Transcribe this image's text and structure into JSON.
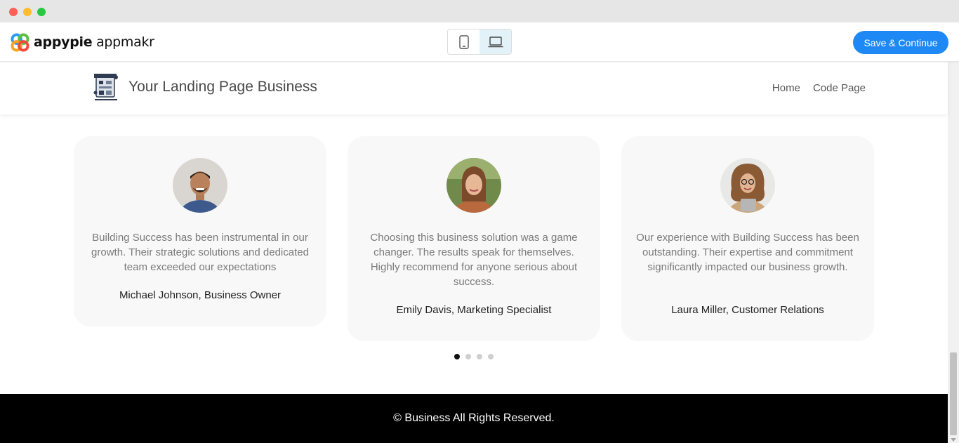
{
  "window": {
    "controls": [
      "close",
      "minimize",
      "maximize"
    ]
  },
  "toolbar": {
    "brand_bold": "appypie",
    "brand_light": "appmakr",
    "device_toggle": {
      "options": [
        "mobile-icon",
        "desktop-icon"
      ],
      "selected": "desktop"
    },
    "save_label": "Save & Continue",
    "accent_color": "#1e88f5"
  },
  "site": {
    "title": "Your Landing Page Business",
    "nav": {
      "home": "Home",
      "code_page": "Code Page"
    }
  },
  "testimonials": [
    {
      "quote": "Building Success has been instrumental in our growth. Their strategic solutions and dedicated team exceeded our expectations",
      "author": "Michael Johnson, Business Owner"
    },
    {
      "quote": "Choosing this business solution was a game changer. The results speak for themselves. Highly recommend for anyone serious about success.",
      "author": "Emily Davis, Marketing Specialist"
    },
    {
      "quote": "Our experience with Building Success has been outstanding. Their expertise and commitment significantly impacted our business growth.",
      "author": "Laura Miller, Customer Relations"
    }
  ],
  "carousel": {
    "pages": 4,
    "active_index": 0
  },
  "footer": {
    "copyright": "© Business All Rights Reserved."
  }
}
